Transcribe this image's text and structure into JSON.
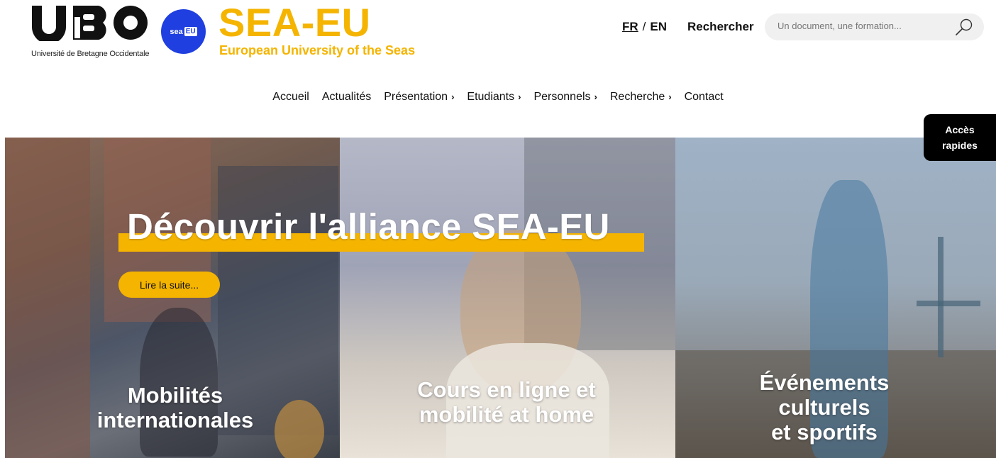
{
  "header": {
    "ubo_caption": "Université de Bretagne Occidentale",
    "seaeu_badge": "sea-EU",
    "seaeu_badge_left": "sea",
    "seaeu_badge_right": "EU",
    "seaeu_title": "SEA-EU",
    "seaeu_subtitle": "European University of the Seas",
    "lang_fr": "FR",
    "lang_sep": "/",
    "lang_en": "EN",
    "search_label": "Rechercher",
    "search_placeholder": "Un document, une formation..."
  },
  "nav": {
    "items": [
      {
        "label": "Accueil",
        "chevron": ""
      },
      {
        "label": "Actualités",
        "chevron": ""
      },
      {
        "label": "Présentation",
        "chevron": "›"
      },
      {
        "label": "Etudiants",
        "chevron": "›"
      },
      {
        "label": "Personnels",
        "chevron": "›"
      },
      {
        "label": "Recherche",
        "chevron": "›"
      },
      {
        "label": "Contact",
        "chevron": ""
      }
    ]
  },
  "hero": {
    "heading": "Découvrir l'alliance SEA-EU",
    "read_more": "Lire la suite...",
    "panels": [
      {
        "title_line1": "Mobilités",
        "title_line2": "internationales",
        "title_line3": ""
      },
      {
        "title_line1": "Cours en ligne et",
        "title_line2": "mobilité at home",
        "title_line3": ""
      },
      {
        "title_line1": "Événements",
        "title_line2": "culturels",
        "title_line3": "et sportifs"
      }
    ]
  },
  "quick_access": {
    "line1": "Accès",
    "line2": "rapides"
  },
  "colors": {
    "accent": "#f4b400",
    "brand_blue": "#1f3fe0"
  },
  "icons": {
    "search": "magnifier-icon"
  }
}
